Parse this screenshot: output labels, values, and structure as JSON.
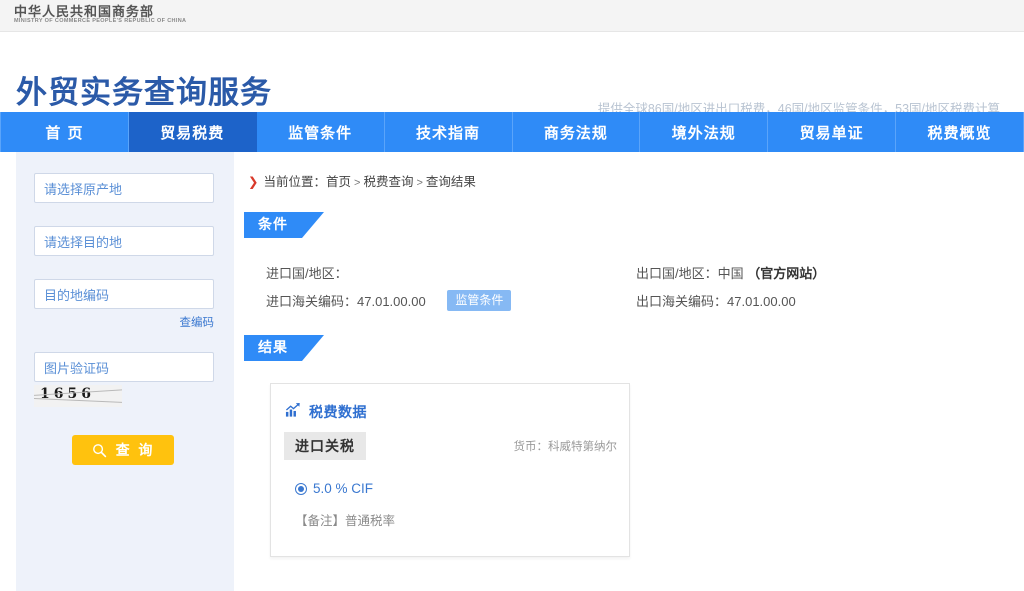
{
  "gov_bar": {
    "name_cn": "中华人民共和国商务部",
    "name_en": "MINISTRY OF COMMERCE PEOPLE'S REPUBLIC OF CHINA"
  },
  "header": {
    "site_title": "外贸实务查询服务",
    "site_url": "wmsw.mofcom.gov.cn",
    "slogan": "提供全球86国/地区进出口税费，46国/地区监管条件，53国/地区税费计算"
  },
  "nav": {
    "items": [
      {
        "label": "首 页",
        "active": false
      },
      {
        "label": "贸易税费",
        "active": true
      },
      {
        "label": "监管条件",
        "active": false
      },
      {
        "label": "技术指南",
        "active": false
      },
      {
        "label": "商务法规",
        "active": false
      },
      {
        "label": "境外法规",
        "active": false
      },
      {
        "label": "贸易单证",
        "active": false
      },
      {
        "label": "税费概览",
        "active": false
      }
    ]
  },
  "sidebar": {
    "origin_placeholder": "请选择原产地",
    "origin_value": "",
    "destination_placeholder": "请选择目的地",
    "destination_value": "",
    "hs_code_placeholder": "目的地编码",
    "hs_code_value": "",
    "find_code_link": "查编码",
    "captcha_placeholder": "图片验证码",
    "captcha_value": "",
    "captcha_image_text": "1656",
    "query_button": "查 询",
    "query_icon": "search-icon"
  },
  "breadcrumb": {
    "arrow": "❯",
    "prefix": "当前位置：",
    "items": [
      "首页",
      "税费查询",
      "查询结果"
    ],
    "separator": ">"
  },
  "conditions": {
    "section_title": "条件",
    "import_country_label": "进口国/地区：",
    "import_country_value": "",
    "import_hs_label": "进口海关编码：",
    "import_hs_value": "47.01.00.00",
    "supervision_badge": "监管条件",
    "export_country_label": "出口国/地区：",
    "export_country_value": "中国",
    "export_country_note": "（官方网站）",
    "export_hs_label": "出口海关编码：",
    "export_hs_value": "47.01.00.00"
  },
  "results": {
    "section_title": "结果",
    "card": {
      "icon": "bar-chart-up-icon",
      "title": "税费数据",
      "tax_type_tag": "进口关税",
      "currency_label": "货币：科威特第纳尔",
      "rate_value": "5.0 % CIF",
      "remark": "【备注】普通税率"
    }
  },
  "colors": {
    "nav_blue": "#2f8bf7",
    "nav_active_blue": "#1d63c9",
    "title_blue": "#2b5aa8",
    "accent_orange": "#ffc20e",
    "badge_blue": "#86b9f4",
    "sidebar_bg": "#eef2fa"
  }
}
